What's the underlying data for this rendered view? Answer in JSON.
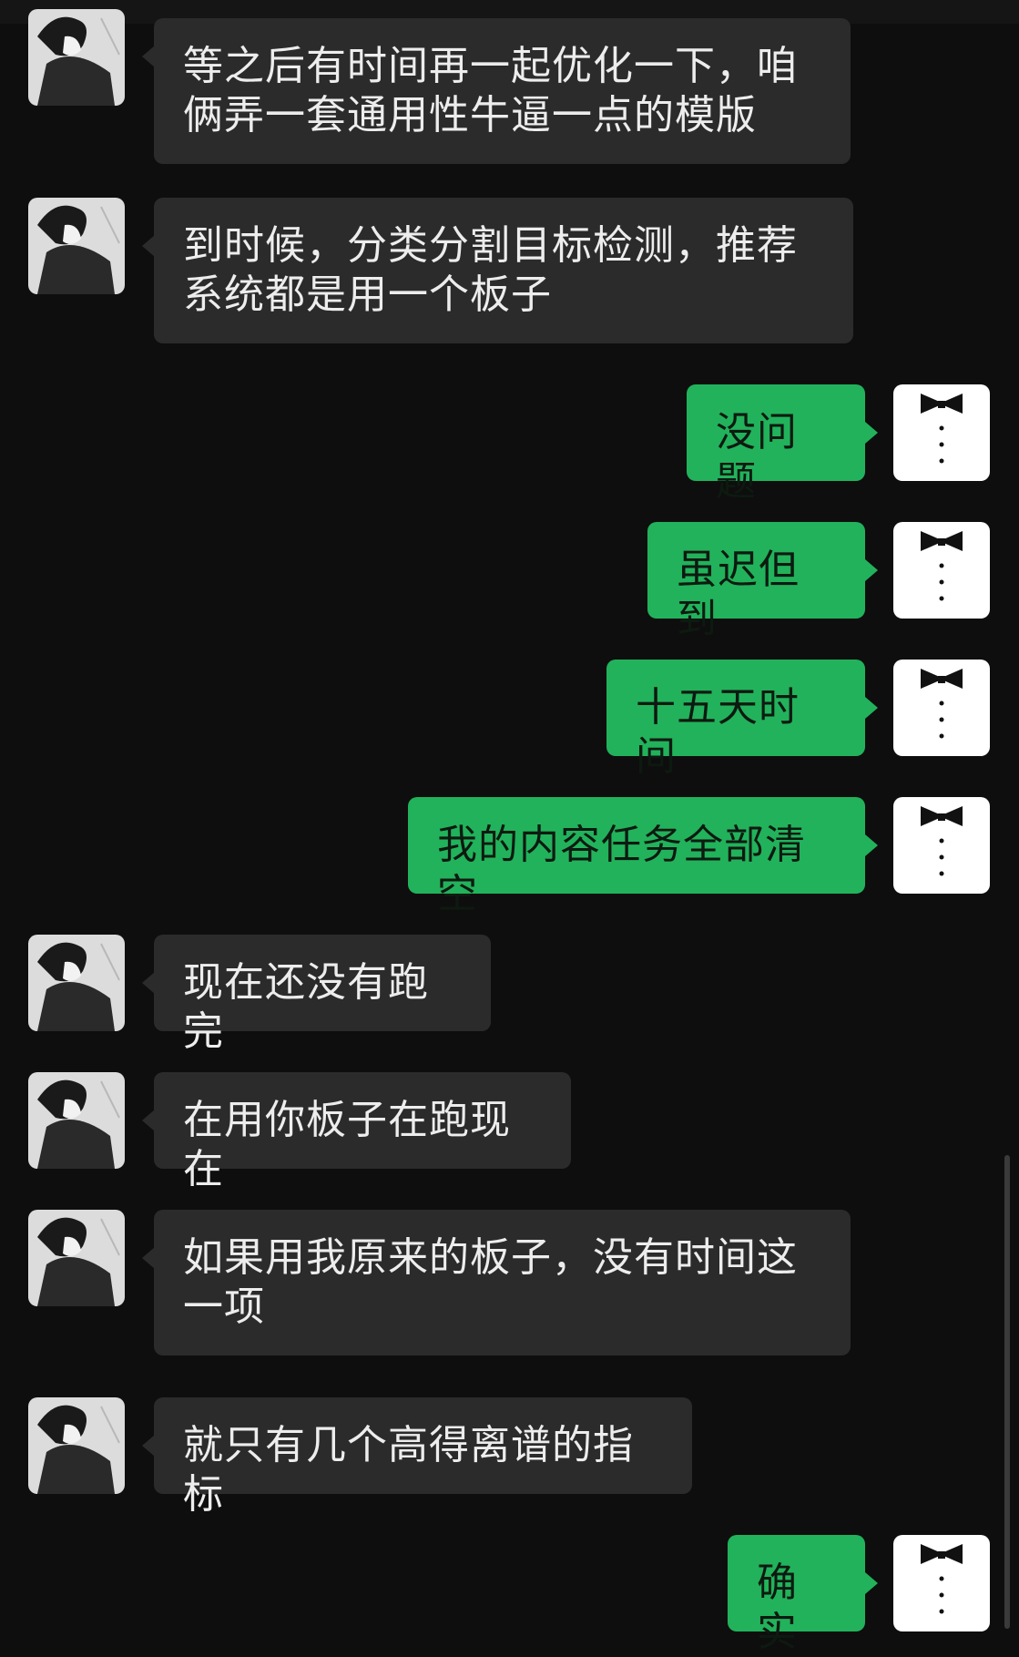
{
  "colors": {
    "background": "#0e0e0e",
    "incoming_bubble": "#2b2b2b",
    "outgoing_bubble": "#22b25b"
  },
  "messages": [
    {
      "side": "in",
      "text": "等之后有时间再一起优化一下，咱俩弄一套通用性牛逼一点的模版"
    },
    {
      "side": "in",
      "text": "到时候，分类分割目标检测，推荐系统都是用一个板子"
    },
    {
      "side": "out",
      "text": "没问题"
    },
    {
      "side": "out",
      "text": "虽迟但到"
    },
    {
      "side": "out",
      "text": "十五天时间"
    },
    {
      "side": "out",
      "text": "我的内容任务全部清空"
    },
    {
      "side": "in",
      "text": "现在还没有跑完"
    },
    {
      "side": "in",
      "text": "在用你板子在跑现在"
    },
    {
      "side": "in",
      "text": "如果用我原来的板子，没有时间这一项"
    },
    {
      "side": "in",
      "text": "就只有几个高得离谱的指标"
    },
    {
      "side": "out",
      "text": "确实"
    }
  ],
  "icons": {
    "incoming_avatar": "anime-character-avatar-icon",
    "outgoing_avatar": "tuxedo-bowtie-avatar-icon"
  }
}
